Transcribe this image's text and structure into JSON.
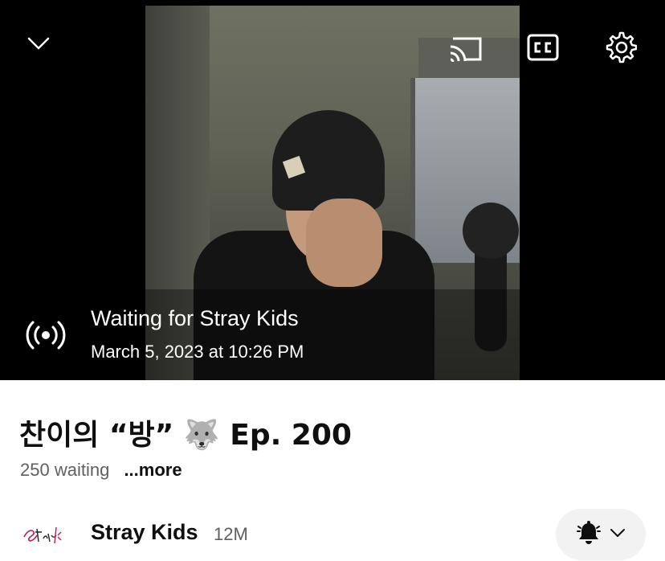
{
  "player": {
    "icons": {
      "collapse": "chevron-down-icon",
      "cast": "cast-icon",
      "captions": "closed-captions-icon",
      "settings": "gear-icon",
      "live": "live-broadcast-icon"
    },
    "live_title": "Waiting for Stray Kids",
    "live_date": "March 5, 2023 at 10:26 PM"
  },
  "video": {
    "title": "찬이의 “방” 🐺 Ep. 200",
    "waiting": "250 waiting",
    "more": "...more"
  },
  "channel": {
    "name": "Stray Kids",
    "subscribers": "12M",
    "logo_text": "Stray Kids",
    "icons": {
      "bell": "bell-icon",
      "dropdown": "chevron-down-icon"
    }
  },
  "colors": {
    "player_bg": "#000000",
    "text_primary": "#0f0f0f",
    "text_secondary": "#606060",
    "button_bg": "#f2f2f2"
  }
}
